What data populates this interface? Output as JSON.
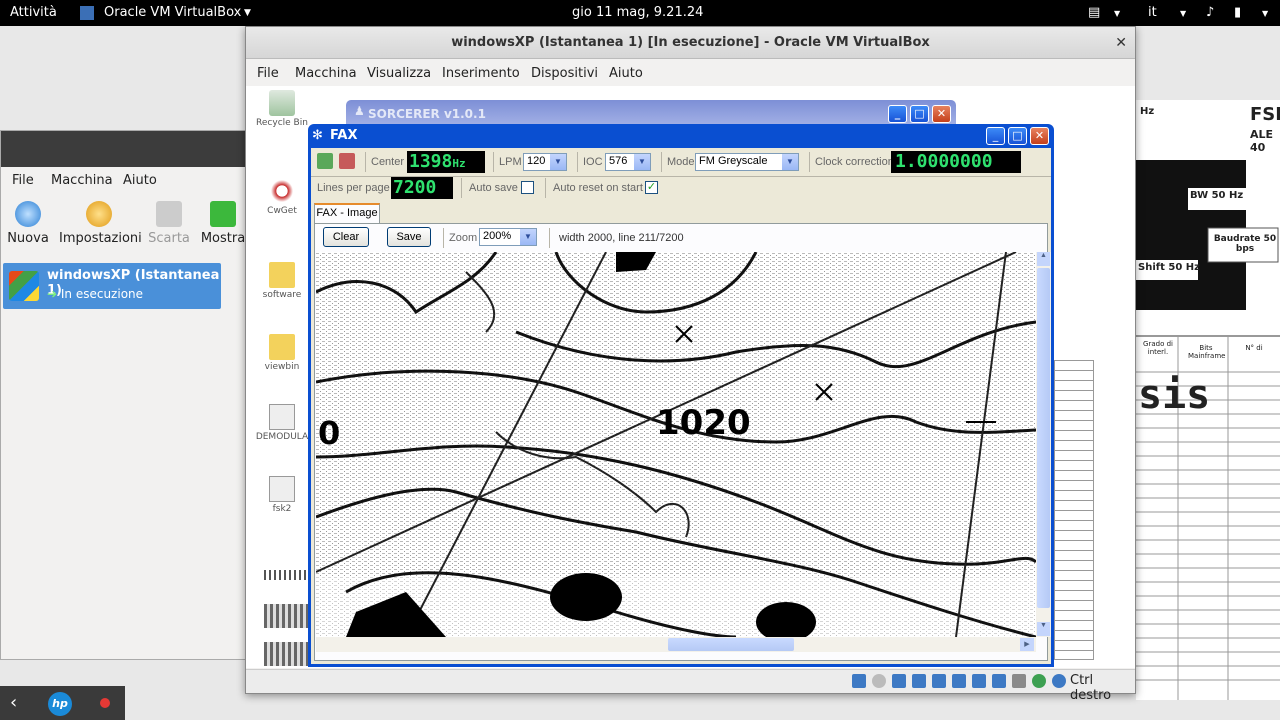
{
  "topbar": {
    "activities": "Attività",
    "app": "Oracle VM VirtualBox",
    "clock": "gio 11 mag,  9.21.24",
    "lang": "it"
  },
  "manager": {
    "menu": [
      "File",
      "Macchina",
      "Aiuto"
    ],
    "tools": [
      "Nuova",
      "Impostazioni",
      "Scarta",
      "Mostra"
    ],
    "vm_name": "windowsXP (Istantanea 1)",
    "vm_state": "In esecuzione"
  },
  "vbox": {
    "title": "windowsXP (Istantanea 1) [In esecuzione] - Oracle VM VirtualBox",
    "menu": [
      "File",
      "Macchina",
      "Visualizza",
      "Inserimento",
      "Dispositivi",
      "Aiuto"
    ],
    "host_key": "Ctrl destro"
  },
  "desktop_icons": [
    "Recycle Bin",
    "CwGet",
    "software",
    "viewbin",
    "DEMODULA",
    "fsk2"
  ],
  "sorcerer": {
    "title": "SORCERER v1.0.1"
  },
  "fax": {
    "title": "FAX",
    "center_label": "Center",
    "center_value": "1398",
    "center_unit": "Hz",
    "lpm_label": "LPM",
    "lpm_value": "120",
    "ioc_label": "IOC",
    "ioc_value": "576",
    "mode_label": "Mode",
    "mode_value": "FM Greyscale",
    "clock_label": "Clock correction",
    "clock_value": "1.0000000",
    "lines_label": "Lines per page",
    "lines_value": "7200",
    "autosave_label": "Auto save",
    "autoreset_label": "Auto reset on start",
    "tab": "FAX - Image",
    "clear": "Clear",
    "save": "Save",
    "zoom_label": "Zoom",
    "zoom_value": "200%",
    "status": "width 2000, line 211/7200",
    "map_label_1020": "1020",
    "map_label_0": "0"
  },
  "rightdoc": {
    "fsk": "FSKI",
    "ale": "ALE 40",
    "bw": "BW 50 Hz",
    "baud": "Baudrate 50 bps",
    "shift": "Shift 50 Hz",
    "sis": "sis",
    "hz": "Hz",
    "col1": "Grado di interl.",
    "col2": "Bits Mainframe",
    "col3": "N° di"
  },
  "colors": {
    "lcd_green": "#2fe26f",
    "xp_blue": "#0a4fd1",
    "vm_selected": "#4a90d9"
  }
}
